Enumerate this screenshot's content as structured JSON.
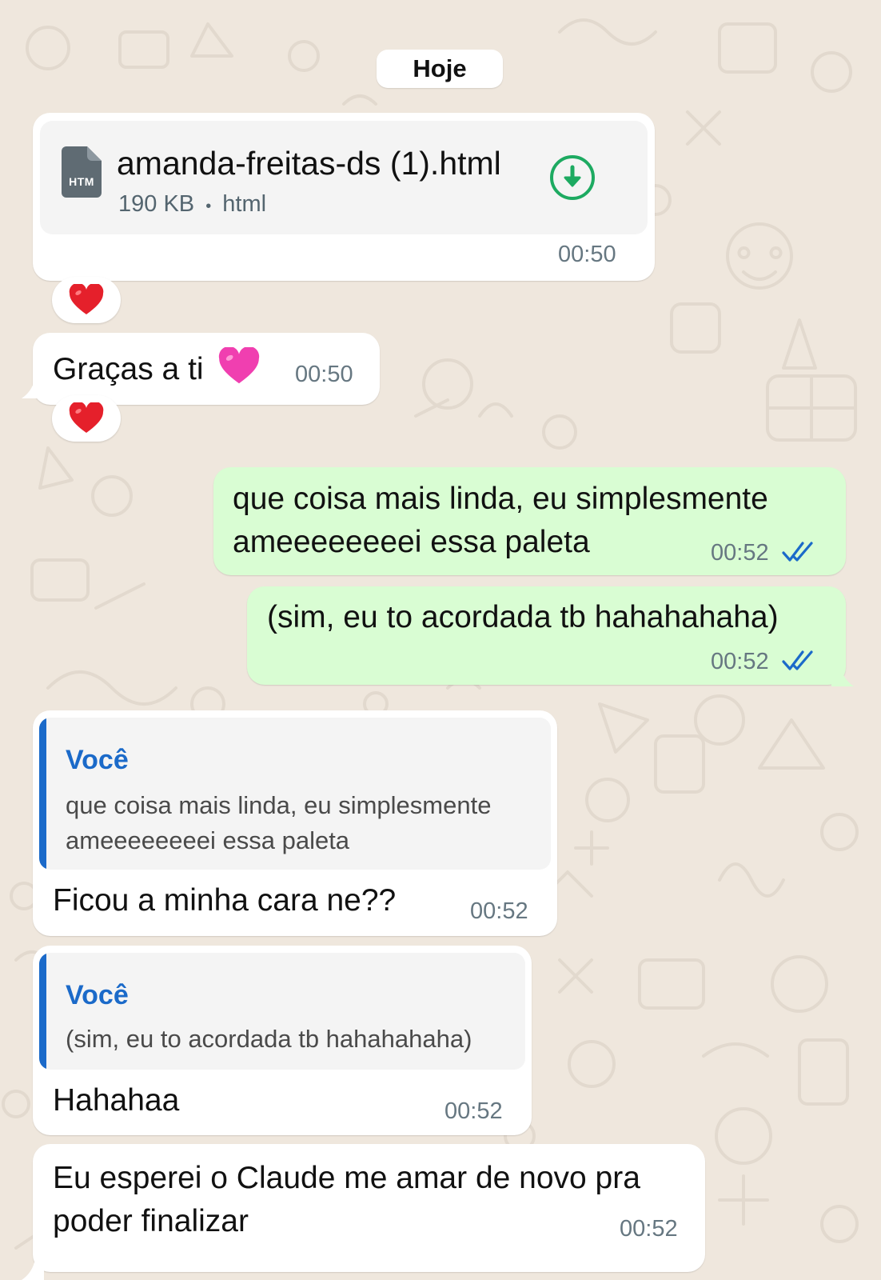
{
  "date_label": "Hoje",
  "file_message": {
    "icon_label": "HTM",
    "file_name": "amanda-freitas-ds (1).html",
    "size": "190 KB",
    "separator": "•",
    "file_type": "html",
    "time": "00:50",
    "reaction": "heart"
  },
  "msg_thanks": {
    "text": "Graças a ti",
    "time": "00:50",
    "reaction": "heart"
  },
  "msg_out_1": {
    "line1": "que coisa mais linda, eu simplesmente",
    "line2": "ameeeeeeeei essa paleta",
    "time": "00:52",
    "status": "read"
  },
  "msg_out_2": {
    "text": "(sim, eu to acordada tb hahahahaha)",
    "time": "00:52",
    "status": "read"
  },
  "reply_1": {
    "quote_author": "Você",
    "quote_line1": "que coisa mais linda, eu simplesmente",
    "quote_line2": "ameeeeeeeei essa paleta",
    "text": "Ficou a minha cara ne??",
    "time": "00:52"
  },
  "reply_2": {
    "quote_author": "Você",
    "quote_line1": "(sim, eu to acordada tb hahahahaha)",
    "text": "Hahahaa",
    "time": "00:52"
  },
  "msg_last": {
    "line1": "Eu esperei o Claude me amar de novo pra",
    "line2": "poder finalizar",
    "time": "00:52"
  },
  "colors": {
    "background": "#efe7dd",
    "incoming": "#ffffff",
    "outgoing": "#d9fdd3",
    "accent_green": "#1daa61",
    "quote_blue": "#1b6ac9",
    "read_ticks": "#53bdeb",
    "heart_red": "#e5202b",
    "heart_pink": "#f03fb0"
  }
}
